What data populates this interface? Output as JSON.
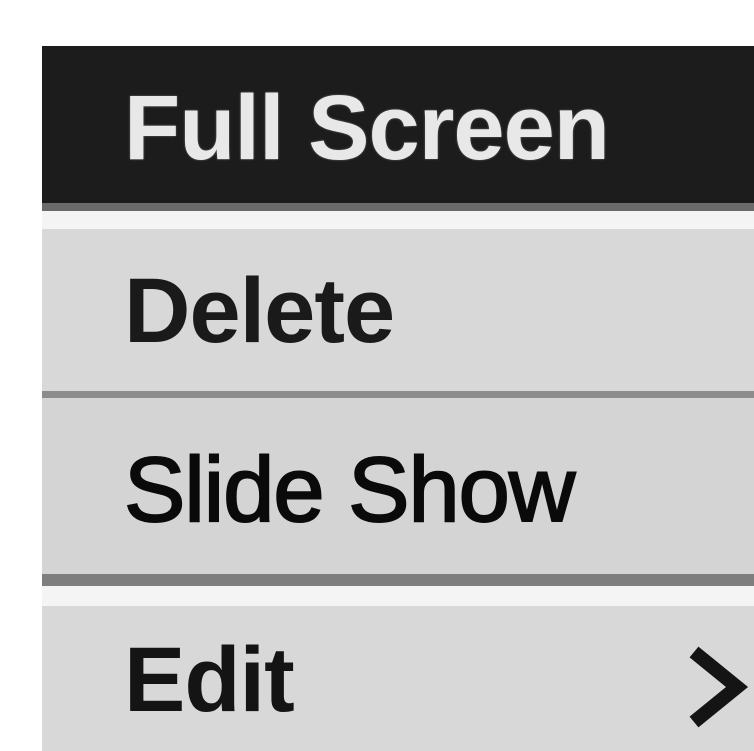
{
  "menu": {
    "items": [
      {
        "label": "Full Screen",
        "selected": true
      },
      {
        "label": "Delete",
        "selected": false
      },
      {
        "label": "Slide Show",
        "selected": false
      },
      {
        "label": "Edit",
        "selected": false,
        "has_submenu": true,
        "submenu_icon": "chevron-right-icon"
      }
    ]
  },
  "colors": {
    "selected_background": "#1c1c1c",
    "selected_text": "#e8e8e8",
    "item_background": "#d8d8d8",
    "separator": "#7e7e7e",
    "text": "#0b0b0b"
  }
}
